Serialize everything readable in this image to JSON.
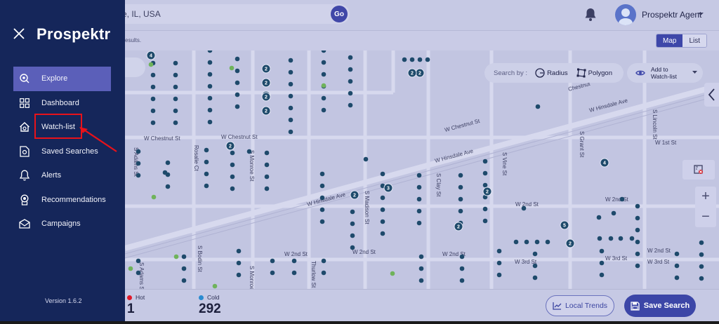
{
  "app": {
    "brand": "Prospektr",
    "version": "Version 1.6.2"
  },
  "topbar": {
    "search_value": "e, IL, USA",
    "go_label": "Go",
    "user_name": "Prospektr Agent"
  },
  "subbar": {
    "results_text": "esults.",
    "view_toggle": {
      "map": "Map",
      "list": "List",
      "selected": "Map"
    }
  },
  "sidebar": {
    "items": [
      {
        "label": "Explore",
        "icon": "compass-pin-icon",
        "active": true
      },
      {
        "label": "Dashboard",
        "icon": "grid-icon",
        "active": false
      },
      {
        "label": "Watch-list",
        "icon": "house-search-icon",
        "active": false
      },
      {
        "label": "Saved Searches",
        "icon": "saved-doc-icon",
        "active": false
      },
      {
        "label": "Alerts",
        "icon": "bell-icon",
        "active": false
      },
      {
        "label": "Recommendations",
        "icon": "badge-icon",
        "active": false
      },
      {
        "label": "Campaigns",
        "icon": "envelope-icon",
        "active": false
      }
    ]
  },
  "map_controls": {
    "search_by_label": "Search by :",
    "radius_label": "Radius",
    "polygon_label": "Polygon",
    "watchlist_add_line1": "Add to",
    "watchlist_add_line2": "Watch-list",
    "zoom_in": "+",
    "zoom_out": "−"
  },
  "map": {
    "street_labels": [
      "W Chestnut St",
      "W Chestnut St",
      "W Chestnut St",
      "Chestnut",
      "W Hinsdale Ave",
      "W Hinsdale Ave",
      "W Hinsdale Ave",
      "W 2nd St",
      "W 2nd St",
      "W 2nd St",
      "W 2nd St",
      "W 2nd St",
      "W 2nd St",
      "W 1st St",
      "W 3rd St",
      "W 3rd St",
      "W 3rd St",
      "S Adams St",
      "S Adams St",
      "Rosalie Ct",
      "S Monroe St",
      "S Monroe St",
      "S Madison St",
      "S Clay St",
      "S Vine St",
      "S Grant St",
      "S Lincoln St",
      "Thurlow St",
      "S Bodin St"
    ],
    "clusters": [
      "4",
      "2",
      "2",
      "2",
      "2",
      "2",
      "2",
      "3",
      "2",
      "2",
      "4",
      "5",
      "2",
      "2",
      "2",
      "2"
    ]
  },
  "stats": {
    "hot_label": "Hot",
    "hot_value": "1",
    "hot_color": "#e0192a",
    "cold_label": "Cold",
    "cold_value": "292",
    "cold_color": "#2a8bd0"
  },
  "bottombar": {
    "local_trends_label": "Local Trends",
    "save_search_label": "Save Search"
  },
  "colors": {
    "sidebar_bg": "#15265a",
    "active_nav": "#5b5fb9",
    "accent": "#3c46a7",
    "pin_cold": "#1e4a6b",
    "pin_green": "#6fb35b",
    "annotation": "#e8121a"
  }
}
